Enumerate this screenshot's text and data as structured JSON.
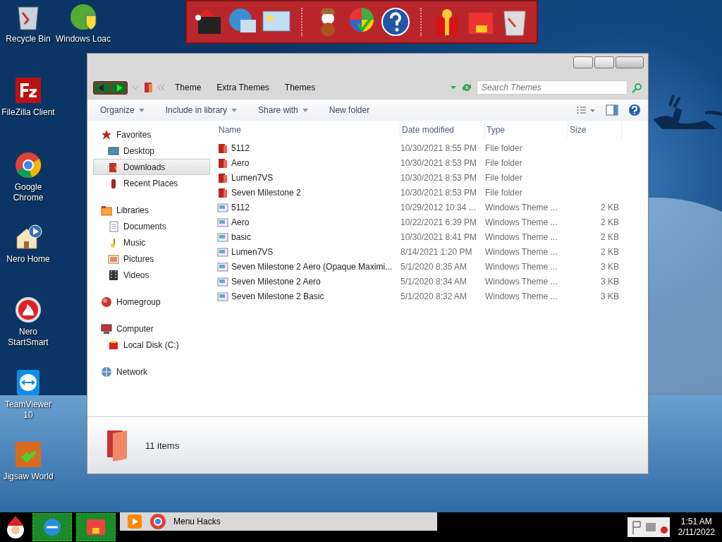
{
  "desktop_icons": [
    {
      "label": "Recycle Bin",
      "kind": "recycle"
    },
    {
      "label": "Windows Loac",
      "kind": "shield"
    },
    {
      "label": "FileZilla Client",
      "kind": "fz"
    },
    {
      "label": "Google Chrome",
      "kind": "chrome"
    },
    {
      "label": "Nero Home",
      "kind": "house"
    },
    {
      "label": "Nero StartSmart",
      "kind": "flame"
    },
    {
      "label": "TeamViewer 10",
      "kind": "tv"
    },
    {
      "label": "Jigsaw World",
      "kind": "puzzle"
    }
  ],
  "explorer": {
    "breadcrumb": [
      "Theme",
      "Extra Themes",
      "Themes"
    ],
    "search": {
      "placeholder": "Search Themes"
    },
    "toolbar": [
      {
        "label": "Organize",
        "has_menu": true
      },
      {
        "label": "Include in library",
        "has_menu": true
      },
      {
        "label": "Share with",
        "has_menu": true
      },
      {
        "label": "New folder",
        "has_menu": false
      }
    ],
    "nav": [
      {
        "label": "Favorites",
        "kind": "star",
        "selected": false,
        "children": [
          {
            "label": "Desktop",
            "kind": "desktop",
            "selected": false
          },
          {
            "label": "Downloads",
            "kind": "download",
            "selected": true
          },
          {
            "label": "Recent Places",
            "kind": "recent",
            "selected": false
          }
        ]
      },
      {
        "label": "Libraries",
        "kind": "library",
        "selected": false,
        "children": [
          {
            "label": "Documents",
            "kind": "document",
            "selected": false
          },
          {
            "label": "Music",
            "kind": "music",
            "selected": false
          },
          {
            "label": "Pictures",
            "kind": "picture",
            "selected": false
          },
          {
            "label": "Videos",
            "kind": "video",
            "selected": false
          }
        ]
      },
      {
        "label": "Homegroup",
        "kind": "homegroup",
        "selected": false
      },
      {
        "label": "Computer",
        "kind": "computer",
        "selected": false,
        "children": [
          {
            "label": "Local Disk (C:)",
            "kind": "disk",
            "selected": false
          }
        ]
      },
      {
        "label": "Network",
        "kind": "network",
        "selected": false
      }
    ],
    "columns": [
      "Name",
      "Date modified",
      "Type",
      "Size"
    ],
    "rows": [
      {
        "name": "5112",
        "date": "10/30/2021 8:55 PM",
        "type": "File folder",
        "size": "",
        "kind": "folder"
      },
      {
        "name": "Aero",
        "date": "10/30/2021 8:53 PM",
        "type": "File folder",
        "size": "",
        "kind": "folder"
      },
      {
        "name": "Lumen7VS",
        "date": "10/30/2021 8:53 PM",
        "type": "File folder",
        "size": "",
        "kind": "folder"
      },
      {
        "name": "Seven Milestone 2",
        "date": "10/30/2021 8:53 PM",
        "type": "File folder",
        "size": "",
        "kind": "folder"
      },
      {
        "name": "5112",
        "date": "10/29/2012 10:34 ...",
        "type": "Windows Theme ...",
        "size": "2 KB",
        "kind": "theme"
      },
      {
        "name": "Aero",
        "date": "10/22/2021 6:39 PM",
        "type": "Windows Theme ...",
        "size": "2 KB",
        "kind": "theme"
      },
      {
        "name": "basic",
        "date": "10/30/2021 8:41 PM",
        "type": "Windows Theme ...",
        "size": "2 KB",
        "kind": "theme"
      },
      {
        "name": "Lumen7VS",
        "date": "8/14/2021 1:20 PM",
        "type": "Windows Theme ...",
        "size": "2 KB",
        "kind": "theme"
      },
      {
        "name": "Seven Milestone 2 Aero (Opaque Maximi...",
        "date": "5/1/2020 8:35 AM",
        "type": "Windows Theme ...",
        "size": "3 KB",
        "kind": "theme"
      },
      {
        "name": "Seven Milestone 2 Aero",
        "date": "5/1/2020 8:34 AM",
        "type": "Windows Theme ...",
        "size": "3 KB",
        "kind": "theme"
      },
      {
        "name": "Seven Milestone 2 Basic",
        "date": "5/1/2020 8:32 AM",
        "type": "Windows Theme ...",
        "size": "3 KB",
        "kind": "theme"
      }
    ],
    "status": "11 items"
  },
  "taskbar": {
    "window_label": "Menu Hacks",
    "time": "1:51 AM",
    "date": "2/11/2022"
  }
}
